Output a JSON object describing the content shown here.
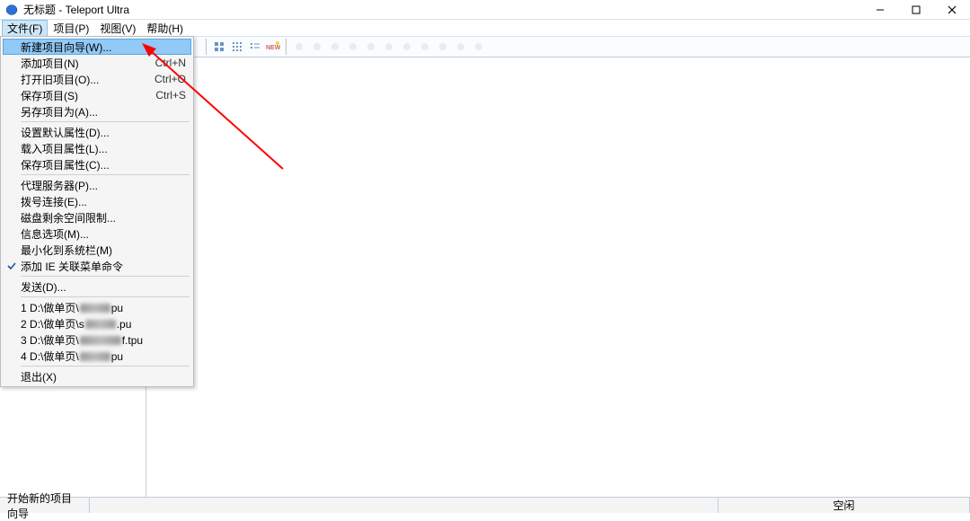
{
  "window": {
    "title": "无标题 - Teleport Ultra"
  },
  "menubar": {
    "items": [
      {
        "label": "文件(F)",
        "active": true
      },
      {
        "label": "项目(P)",
        "active": false
      },
      {
        "label": "视图(V)",
        "active": false
      },
      {
        "label": "帮助(H)",
        "active": false
      }
    ]
  },
  "file_menu": {
    "new_wizard": {
      "label": "新建项目向导(W)...",
      "highlighted": true
    },
    "add_item": {
      "label": "添加项目(N)",
      "shortcut": "Ctrl+N"
    },
    "open_old": {
      "label": "打开旧项目(O)...",
      "shortcut": "Ctrl+O"
    },
    "save": {
      "label": "保存项目(S)",
      "shortcut": "Ctrl+S"
    },
    "save_as": {
      "label": "另存项目为(A)..."
    },
    "set_default_props": {
      "label": "设置默认属性(D)..."
    },
    "load_props": {
      "label": "载入项目属性(L)..."
    },
    "save_props": {
      "label": "保存项目属性(C)..."
    },
    "proxy": {
      "label": "代理服务器(P)..."
    },
    "dialup": {
      "label": "拨号连接(E)..."
    },
    "disk_limit": {
      "label": "磁盘剩余空间限制..."
    },
    "info_options": {
      "label": "信息选项(M)..."
    },
    "min_to_tray": {
      "label": "最小化到系统栏(M)"
    },
    "add_ie_context": {
      "label": "添加 IE 关联菜单命令",
      "checked": true
    },
    "send": {
      "label": "发送(D)..."
    },
    "recent_prefix": "D:\\做单页\\",
    "recent": [
      {
        "n": "1",
        "suffix": "pu"
      },
      {
        "n": "2",
        "suffix": ".pu"
      },
      {
        "n": "3",
        "suffix": "f.tpu"
      },
      {
        "n": "4",
        "suffix": "pu"
      }
    ],
    "exit": {
      "label": "退出(X)"
    }
  },
  "statusbar": {
    "left": "开始新的项目向导",
    "idle": "空闲"
  }
}
